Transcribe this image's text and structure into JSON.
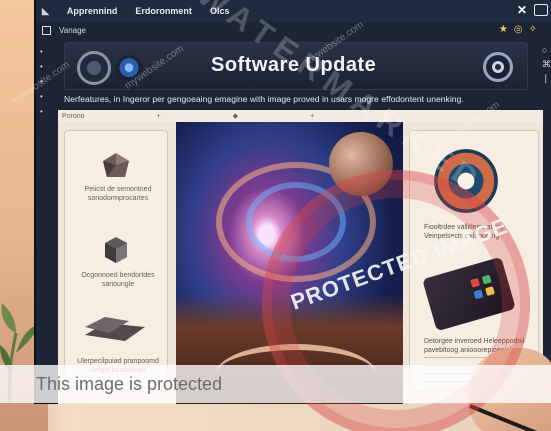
{
  "window": {
    "menu": [
      "Apprennind",
      "Erdoronment",
      "Olcs"
    ],
    "subbar_label": "Vanage",
    "panel_label": "Porono"
  },
  "header": {
    "title": "Software Update"
  },
  "features_text": "Nerfeatures, in Ingeror per gengoeaing emagine with image proved in usars mogre effodontent unenking.",
  "left_panel": {
    "items": [
      {
        "caption": "Peiicst de semontned sonodormprocartes"
      },
      {
        "caption": "Ocgonnoed bendortdes sanoungle"
      },
      {
        "caption": "Ulerpecilpuiad pranpoomd Uargie bouibilmals"
      }
    ]
  },
  "right_panel": {
    "captions": [
      "Fiooltrdee vallitlernuatnay Veinpelsectsenilirooping",
      "Detorgee inveroed Heleeppodoil pavebltoog aniooorepioaniol"
    ]
  },
  "overlays": {
    "protected_banner": "This image is protected",
    "stamp": "PROTECTED IMAGE",
    "watermark": "WATERMARKED",
    "site": "mywebsite.com"
  },
  "colors": {
    "accent": "#202a3e",
    "stamp": "#d64444"
  }
}
